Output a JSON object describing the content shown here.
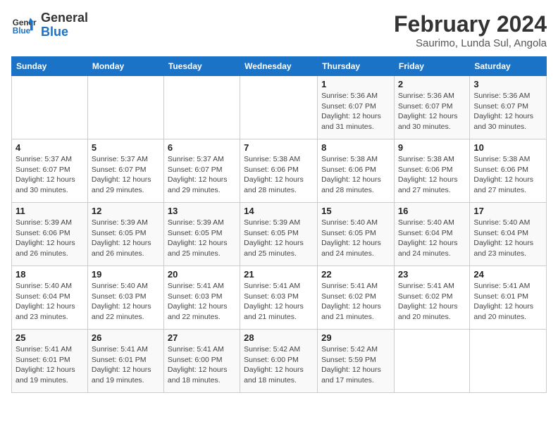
{
  "logo": {
    "text_general": "General",
    "text_blue": "Blue"
  },
  "header": {
    "title": "February 2024",
    "subtitle": "Saurimo, Lunda Sul, Angola"
  },
  "days_of_week": [
    "Sunday",
    "Monday",
    "Tuesday",
    "Wednesday",
    "Thursday",
    "Friday",
    "Saturday"
  ],
  "weeks": [
    [
      {
        "day": "",
        "info": ""
      },
      {
        "day": "",
        "info": ""
      },
      {
        "day": "",
        "info": ""
      },
      {
        "day": "",
        "info": ""
      },
      {
        "day": "1",
        "info": "Sunrise: 5:36 AM\nSunset: 6:07 PM\nDaylight: 12 hours and 31 minutes."
      },
      {
        "day": "2",
        "info": "Sunrise: 5:36 AM\nSunset: 6:07 PM\nDaylight: 12 hours and 30 minutes."
      },
      {
        "day": "3",
        "info": "Sunrise: 5:36 AM\nSunset: 6:07 PM\nDaylight: 12 hours and 30 minutes."
      }
    ],
    [
      {
        "day": "4",
        "info": "Sunrise: 5:37 AM\nSunset: 6:07 PM\nDaylight: 12 hours and 30 minutes."
      },
      {
        "day": "5",
        "info": "Sunrise: 5:37 AM\nSunset: 6:07 PM\nDaylight: 12 hours and 29 minutes."
      },
      {
        "day": "6",
        "info": "Sunrise: 5:37 AM\nSunset: 6:07 PM\nDaylight: 12 hours and 29 minutes."
      },
      {
        "day": "7",
        "info": "Sunrise: 5:38 AM\nSunset: 6:06 PM\nDaylight: 12 hours and 28 minutes."
      },
      {
        "day": "8",
        "info": "Sunrise: 5:38 AM\nSunset: 6:06 PM\nDaylight: 12 hours and 28 minutes."
      },
      {
        "day": "9",
        "info": "Sunrise: 5:38 AM\nSunset: 6:06 PM\nDaylight: 12 hours and 27 minutes."
      },
      {
        "day": "10",
        "info": "Sunrise: 5:38 AM\nSunset: 6:06 PM\nDaylight: 12 hours and 27 minutes."
      }
    ],
    [
      {
        "day": "11",
        "info": "Sunrise: 5:39 AM\nSunset: 6:06 PM\nDaylight: 12 hours and 26 minutes."
      },
      {
        "day": "12",
        "info": "Sunrise: 5:39 AM\nSunset: 6:05 PM\nDaylight: 12 hours and 26 minutes."
      },
      {
        "day": "13",
        "info": "Sunrise: 5:39 AM\nSunset: 6:05 PM\nDaylight: 12 hours and 25 minutes."
      },
      {
        "day": "14",
        "info": "Sunrise: 5:39 AM\nSunset: 6:05 PM\nDaylight: 12 hours and 25 minutes."
      },
      {
        "day": "15",
        "info": "Sunrise: 5:40 AM\nSunset: 6:05 PM\nDaylight: 12 hours and 24 minutes."
      },
      {
        "day": "16",
        "info": "Sunrise: 5:40 AM\nSunset: 6:04 PM\nDaylight: 12 hours and 24 minutes."
      },
      {
        "day": "17",
        "info": "Sunrise: 5:40 AM\nSunset: 6:04 PM\nDaylight: 12 hours and 23 minutes."
      }
    ],
    [
      {
        "day": "18",
        "info": "Sunrise: 5:40 AM\nSunset: 6:04 PM\nDaylight: 12 hours and 23 minutes."
      },
      {
        "day": "19",
        "info": "Sunrise: 5:40 AM\nSunset: 6:03 PM\nDaylight: 12 hours and 22 minutes."
      },
      {
        "day": "20",
        "info": "Sunrise: 5:41 AM\nSunset: 6:03 PM\nDaylight: 12 hours and 22 minutes."
      },
      {
        "day": "21",
        "info": "Sunrise: 5:41 AM\nSunset: 6:03 PM\nDaylight: 12 hours and 21 minutes."
      },
      {
        "day": "22",
        "info": "Sunrise: 5:41 AM\nSunset: 6:02 PM\nDaylight: 12 hours and 21 minutes."
      },
      {
        "day": "23",
        "info": "Sunrise: 5:41 AM\nSunset: 6:02 PM\nDaylight: 12 hours and 20 minutes."
      },
      {
        "day": "24",
        "info": "Sunrise: 5:41 AM\nSunset: 6:01 PM\nDaylight: 12 hours and 20 minutes."
      }
    ],
    [
      {
        "day": "25",
        "info": "Sunrise: 5:41 AM\nSunset: 6:01 PM\nDaylight: 12 hours and 19 minutes."
      },
      {
        "day": "26",
        "info": "Sunrise: 5:41 AM\nSunset: 6:01 PM\nDaylight: 12 hours and 19 minutes."
      },
      {
        "day": "27",
        "info": "Sunrise: 5:41 AM\nSunset: 6:00 PM\nDaylight: 12 hours and 18 minutes."
      },
      {
        "day": "28",
        "info": "Sunrise: 5:42 AM\nSunset: 6:00 PM\nDaylight: 12 hours and 18 minutes."
      },
      {
        "day": "29",
        "info": "Sunrise: 5:42 AM\nSunset: 5:59 PM\nDaylight: 12 hours and 17 minutes."
      },
      {
        "day": "",
        "info": ""
      },
      {
        "day": "",
        "info": ""
      }
    ]
  ]
}
